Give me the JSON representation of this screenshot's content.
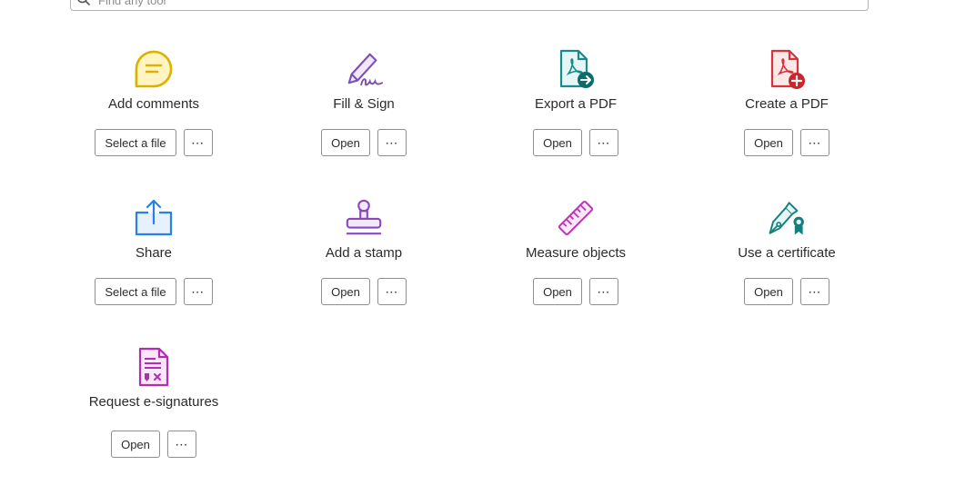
{
  "search": {
    "placeholder": "Find any tool"
  },
  "tools": [
    {
      "label": "Add comments",
      "action": "Select a file",
      "more": "⋯",
      "icon": "comment-icon"
    },
    {
      "label": "Fill & Sign",
      "action": "Open",
      "more": "⋯",
      "icon": "pen-signature-icon"
    },
    {
      "label": "Export a PDF",
      "action": "Open",
      "more": "⋯",
      "icon": "export-pdf-icon"
    },
    {
      "label": "Create a PDF",
      "action": "Open",
      "more": "⋯",
      "icon": "create-pdf-icon"
    },
    {
      "label": "Share",
      "action": "Select a file",
      "more": "⋯",
      "icon": "share-icon"
    },
    {
      "label": "Add a stamp",
      "action": "Open",
      "more": "⋯",
      "icon": "stamp-icon"
    },
    {
      "label": "Measure objects",
      "action": "Open",
      "more": "⋯",
      "icon": "ruler-icon"
    },
    {
      "label": "Use a certificate",
      "action": "Open",
      "more": "⋯",
      "icon": "certificate-icon"
    },
    {
      "label": "Request e-signatures",
      "action": "Open",
      "more": "⋯",
      "icon": "e-signature-icon"
    }
  ],
  "colors": {
    "comments": "#d9b300",
    "fill_sign": "#7b4fb8",
    "export": "#1a8a8a",
    "create": "#d9323a",
    "share": "#2680eb",
    "stamp": "#8b47c2",
    "measure": "#b83ab0",
    "certificate": "#138080",
    "esign": "#b02fb0"
  }
}
